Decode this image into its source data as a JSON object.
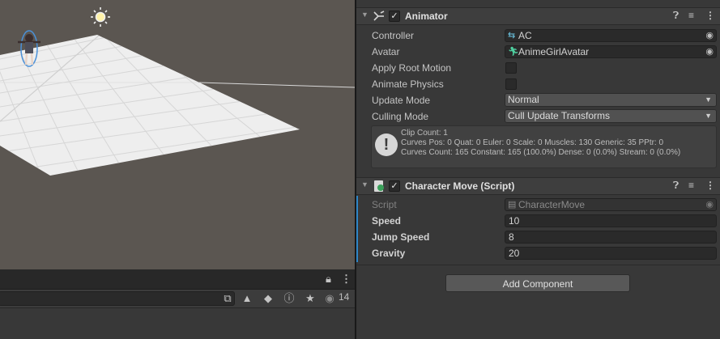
{
  "inspector": {
    "animator": {
      "title": "Animator",
      "enabled": true,
      "icons": [
        "help-icon",
        "presets-icon",
        "more-icon"
      ],
      "properties": {
        "controller": {
          "label": "Controller",
          "value": "AC"
        },
        "avatar": {
          "label": "Avatar",
          "value": "AnimeGirlAvatar"
        },
        "apply_root_motion": {
          "label": "Apply Root Motion",
          "checked": false
        },
        "animate_physics": {
          "label": "Animate Physics",
          "checked": false
        },
        "update_mode": {
          "label": "Update Mode",
          "value": "Normal"
        },
        "culling_mode": {
          "label": "Culling Mode",
          "value": "Cull Update Transforms"
        }
      },
      "info": {
        "line1": "Clip Count: 1",
        "line2": "Curves Pos: 0 Quat: 0 Euler: 0 Scale: 0 Muscles: 130 Generic: 35 PPtr: 0",
        "line3": "Curves Count: 165 Constant: 165 (100.0%) Dense: 0 (0.0%) Stream: 0 (0.0%)"
      }
    },
    "character_move": {
      "title": "Character Move (Script)",
      "enabled": true,
      "properties": {
        "script": {
          "label": "Script",
          "value": "CharacterMove"
        },
        "speed": {
          "label": "Speed",
          "value": "10"
        },
        "jump_speed": {
          "label": "Jump Speed",
          "value": "8"
        },
        "gravity": {
          "label": "Gravity",
          "value": "20"
        }
      }
    },
    "add_component_label": "Add Component"
  },
  "bottom_panel": {
    "visible_count": "14",
    "icons": [
      "lock-icon",
      "more-icon",
      "scene-search-icon",
      "type-filter-icon",
      "label-filter-icon",
      "warning-filter-icon",
      "favorite-icon",
      "visibility-icon"
    ]
  },
  "colors": {
    "accent": "#2e86c8",
    "panel_bg": "#383838",
    "scene_bg": "#5b5651"
  }
}
